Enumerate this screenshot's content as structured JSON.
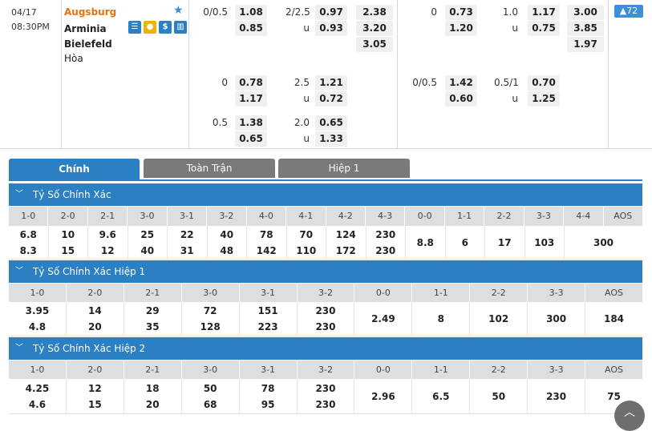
{
  "match": {
    "date": "04/17",
    "time": "08:30PM",
    "home": "Augsburg",
    "away": "Arminia Bielefeld",
    "draw": "Hòa",
    "more_count": "72"
  },
  "odds": {
    "ft_hdp": [
      {
        "line": "0/0.5",
        "home": "1.08",
        "away": "0.85"
      },
      {
        "line": "0",
        "home": "0.78",
        "away": "1.17"
      },
      {
        "line": "0.5",
        "home": "1.38",
        "away": "0.65"
      }
    ],
    "ft_ou": [
      {
        "line": "2/2.5",
        "over": "0.97",
        "under_label": "u",
        "under": "0.93"
      },
      {
        "line": "2.5",
        "over": "1.21",
        "under_label": "u",
        "under": "0.72"
      },
      {
        "line": "2.0",
        "over": "0.65",
        "under_label": "u",
        "under": "1.33"
      }
    ],
    "ft_1x2": [
      "2.38",
      "3.20",
      "3.05"
    ],
    "h1_hdp": [
      {
        "line": "0",
        "home": "0.73",
        "away": "1.20"
      },
      {
        "line": "0/0.5",
        "home": "1.42",
        "away": "0.60"
      }
    ],
    "h1_ou": [
      {
        "line": "1.0",
        "over": "1.17",
        "under_label": "u",
        "under": "0.75"
      },
      {
        "line": "0.5/1",
        "over": "0.70",
        "under_label": "u",
        "under": "1.25"
      }
    ],
    "h1_1x2": [
      "3.00",
      "3.85",
      "1.97"
    ]
  },
  "tabs": [
    "Chính",
    "Toàn Trận",
    "Hiệp 1"
  ],
  "sections": [
    {
      "title": "Tỷ Số Chính Xác",
      "headers": [
        "1-0",
        "2-0",
        "2-1",
        "3-0",
        "3-1",
        "3-2",
        "4-0",
        "4-1",
        "4-2",
        "4-3",
        "0-0",
        "1-1",
        "2-2",
        "3-3",
        "4-4",
        "AOS"
      ],
      "cells": [
        [
          "6.8",
          "8.3"
        ],
        [
          "10",
          "15"
        ],
        [
          "9.6",
          "12"
        ],
        [
          "25",
          "40"
        ],
        [
          "22",
          "31"
        ],
        [
          "40",
          "48"
        ],
        [
          "78",
          "142"
        ],
        [
          "70",
          "110"
        ],
        [
          "124",
          "172"
        ],
        [
          "230",
          "230"
        ],
        [
          "8.8"
        ],
        [
          "6"
        ],
        [
          "17"
        ],
        [
          "103"
        ],
        [
          "300"
        ]
      ]
    },
    {
      "title": "Tỷ Số Chính Xác Hiệp 1",
      "headers": [
        "1-0",
        "2-0",
        "2-1",
        "3-0",
        "3-1",
        "3-2",
        "0-0",
        "1-1",
        "2-2",
        "3-3",
        "AOS"
      ],
      "cells": [
        [
          "3.95",
          "4.8"
        ],
        [
          "14",
          "20"
        ],
        [
          "29",
          "35"
        ],
        [
          "72",
          "128"
        ],
        [
          "151",
          "223"
        ],
        [
          "230",
          "230"
        ],
        [
          "2.49"
        ],
        [
          "8"
        ],
        [
          "102"
        ],
        [
          "300"
        ],
        [
          "184"
        ]
      ]
    },
    {
      "title": "Tỷ Số Chính Xác Hiệp 2",
      "headers": [
        "1-0",
        "2-0",
        "2-1",
        "3-0",
        "3-1",
        "3-2",
        "0-0",
        "1-1",
        "2-2",
        "3-3",
        "AOS"
      ],
      "cells": [
        [
          "4.25",
          "4.6"
        ],
        [
          "12",
          "15"
        ],
        [
          "18",
          "20"
        ],
        [
          "50",
          "68"
        ],
        [
          "78",
          "95"
        ],
        [
          "230",
          "230"
        ],
        [
          "2.96"
        ],
        [
          "6.5"
        ],
        [
          "50"
        ],
        [
          "230"
        ],
        [
          "75"
        ]
      ]
    }
  ],
  "icons": [
    "table-icon",
    "coin-icon",
    "dollar-icon",
    "chart-icon",
    "star-icon",
    "chevron-down-icon",
    "scroll-up-icon"
  ],
  "colors": {
    "accent": "#2b80c4",
    "home_team": "#e8720c",
    "tab_inactive": "#7a7a7a"
  }
}
